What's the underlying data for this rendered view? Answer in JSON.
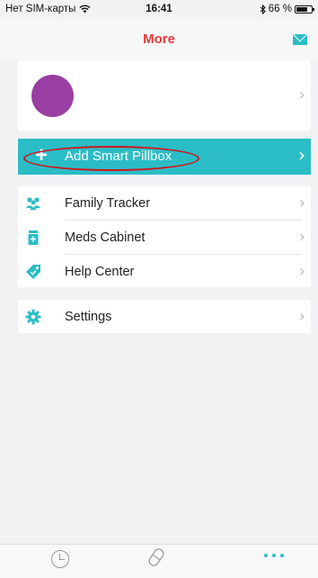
{
  "status_bar": {
    "carrier": "Нет SIM-карты",
    "time": "16:41",
    "bluetooth": "bluetooth-icon",
    "battery": "66 %"
  },
  "nav": {
    "title": "More",
    "title_color": "#e53a3a",
    "mail_icon": "mail-icon"
  },
  "profile": {
    "avatar_color": "#9a3ea3"
  },
  "add_pillbox": {
    "label": "Add Smart Pillbox",
    "icon": "plus-icon",
    "background": "#2bbdc6"
  },
  "menu": {
    "items": [
      {
        "label": "Family Tracker",
        "icon": "family-icon"
      },
      {
        "label": "Meds Cabinet",
        "icon": "meds-cabinet-icon"
      },
      {
        "label": "Help Center",
        "icon": "help-tag-icon"
      }
    ]
  },
  "settings": {
    "label": "Settings",
    "icon": "gear-icon"
  },
  "tab_bar": {
    "tabs": [
      {
        "icon": "clock-icon"
      },
      {
        "icon": "pill-icon"
      },
      {
        "icon": "more-dots-icon",
        "active": true
      }
    ]
  },
  "accent_color": "#2bbdc6"
}
